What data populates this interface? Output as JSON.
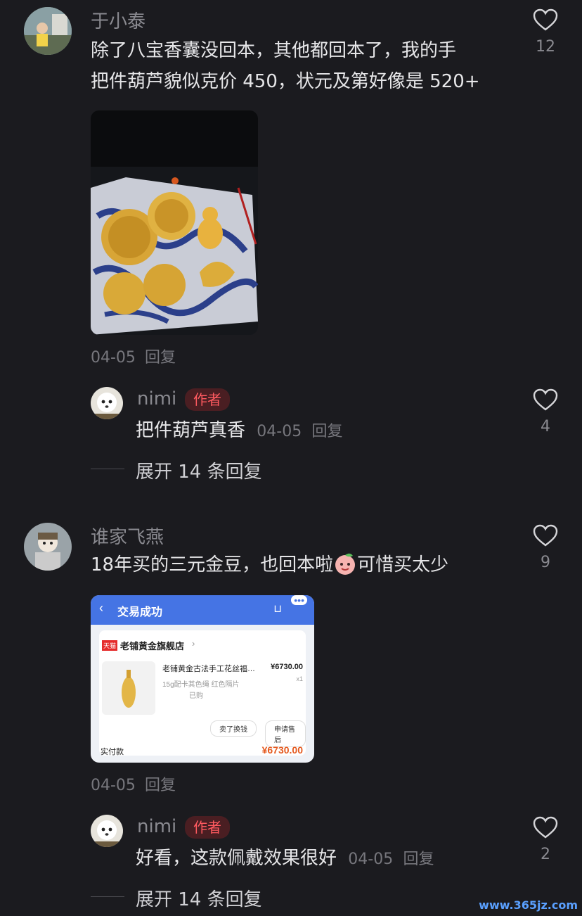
{
  "comments": [
    {
      "user": "于小泰",
      "lines": [
        "除了八宝香囊没回本，其他都回本了，我的手",
        "把件葫芦貌似克价 450，状元及第好像是 520+"
      ],
      "date": "04-05",
      "reply_label": "回复",
      "likes": "12",
      "reply": {
        "user": "nimi",
        "badge": "作者",
        "text": "把件葫芦真香",
        "date": "04-05",
        "reply_label": "回复",
        "likes": "4",
        "expand": "展开 14 条回复"
      }
    },
    {
      "user": "谁家飞燕",
      "text_before_emoji": "18年买的三元金豆，也回本啦",
      "text_after_emoji": "可惜买太少",
      "date": "04-05",
      "reply_label": "回复",
      "likes": "9",
      "order_card": {
        "title": "交易成功",
        "shop_tag": "天猫",
        "shop_name": "老铺黄金旗舰店",
        "product_name": "老铺黄金古法手工花丝福…",
        "product_spec": "15g配卡其色绳 红色隔片",
        "product_status": "已购",
        "price": "¥6730.00",
        "qty": "x1",
        "btn_sell": "卖了换钱",
        "btn_after_sale": "申请售后",
        "paid_label": "实付款",
        "paid_amount": "¥6730.00"
      },
      "reply": {
        "user": "nimi",
        "badge": "作者",
        "text": "好看，这款佩戴效果很好",
        "date": "04-05",
        "reply_label": "回复",
        "likes": "2",
        "expand": "展开 14 条回复"
      }
    }
  ],
  "watermark": "www.365jz.com",
  "colors": {
    "background": "#1b1b1f",
    "badge_text": "#ff5a60",
    "card_header": "#4574e4"
  }
}
